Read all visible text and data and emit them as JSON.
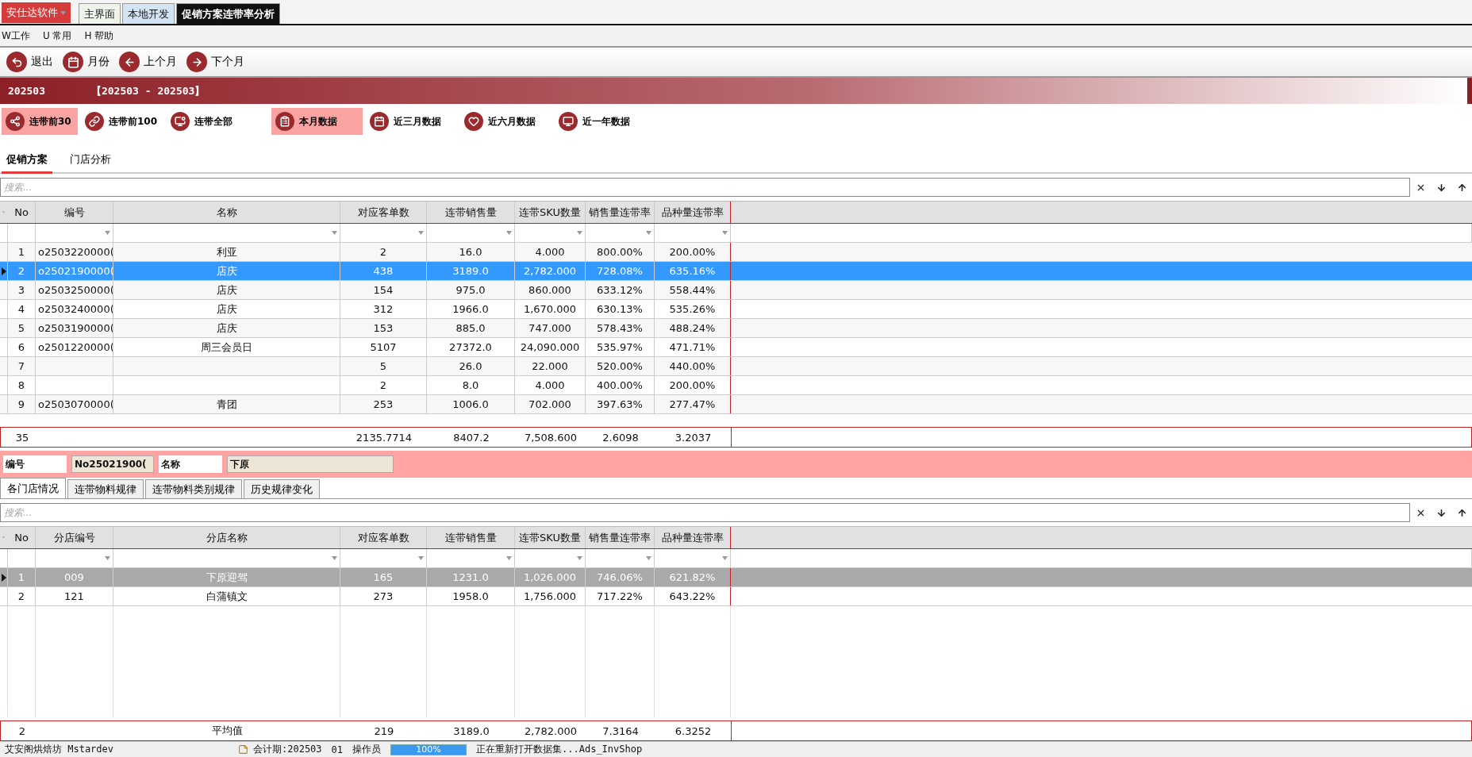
{
  "app_menu": {
    "label": "安仕达软件"
  },
  "window_tabs": [
    {
      "label": "主界面",
      "selected": false,
      "color": "#eef4ea"
    },
    {
      "label": "本地开发",
      "selected": false,
      "color": "#d3e4f5"
    },
    {
      "label": "促销方案连带率分析",
      "selected": true,
      "color": "#111111"
    }
  ],
  "menu": [
    "W工作",
    "U 常用",
    "H 帮助"
  ],
  "toolbar": [
    {
      "label": "退出",
      "kind": "exit"
    },
    {
      "label": "月份",
      "kind": "calendar"
    },
    {
      "label": "上个月",
      "kind": "prev"
    },
    {
      "label": "下个月",
      "kind": "next"
    }
  ],
  "banner": {
    "period": "202503",
    "range": "【202503 - 202503】"
  },
  "scope_buttons": [
    {
      "label": "连带前30",
      "kind": "network",
      "selected": true
    },
    {
      "label": "连带前100",
      "kind": "link",
      "selected": false
    },
    {
      "label": "连带全部",
      "kind": "chart",
      "selected": false
    }
  ],
  "period_buttons": [
    {
      "label": "本月数据",
      "kind": "clipboard",
      "selected": true
    },
    {
      "label": "近三月数据",
      "kind": "calendar",
      "selected": false
    },
    {
      "label": "近六月数据",
      "kind": "heart",
      "selected": false
    },
    {
      "label": "近一年数据",
      "kind": "monitor",
      "selected": false
    }
  ],
  "tabs": [
    {
      "label": "促销方案",
      "selected": true
    },
    {
      "label": "门店分析",
      "selected": false
    }
  ],
  "plan_table": {
    "search": {
      "placeholder": "搜索..."
    },
    "focused": true,
    "columns": [
      "No",
      "编号",
      "名称",
      "对应客单数",
      "连带销售量",
      "连带SKU数量",
      "销售量连带率",
      "品种量连带率"
    ],
    "rows": [
      {
        "no": "1",
        "code": "o2503220000(",
        "name": "利亚",
        "values": [
          "2",
          "16.0",
          "4.000",
          "800.00%",
          "200.00%"
        ],
        "selected": false
      },
      {
        "no": "2",
        "code": "o2502190000(",
        "name": "店庆",
        "values": [
          "438",
          "3189.0",
          "2,782.000",
          "728.08%",
          "635.16%"
        ],
        "selected": true
      },
      {
        "no": "3",
        "code": "o2503250000(",
        "name": "店庆",
        "values": [
          "154",
          "975.0",
          "860.000",
          "633.12%",
          "558.44%"
        ],
        "selected": false
      },
      {
        "no": "4",
        "code": "o2503240000(",
        "name": "店庆",
        "values": [
          "312",
          "1966.0",
          "1,670.000",
          "630.13%",
          "535.26%"
        ],
        "selected": false
      },
      {
        "no": "5",
        "code": "o2503190000(",
        "name": "店庆",
        "values": [
          "153",
          "885.0",
          "747.000",
          "578.43%",
          "488.24%"
        ],
        "selected": false
      },
      {
        "no": "6",
        "code": "o2501220000(",
        "name": "周三会员日",
        "values": [
          "5107",
          "27372.0",
          "24,090.000",
          "535.97%",
          "471.71%"
        ],
        "selected": false
      },
      {
        "no": "7",
        "values": [
          "5",
          "26.0",
          "22.000",
          "520.00%",
          "440.00%"
        ],
        "selected": false
      },
      {
        "no": "8",
        "values": [
          "2",
          "8.0",
          "4.000",
          "400.00%",
          "200.00%"
        ],
        "selected": false
      },
      {
        "no": "9",
        "code": "o2503070000(",
        "name": "青团",
        "values": [
          "253",
          "1006.0",
          "702.000",
          "397.63%",
          "277.47%"
        ],
        "selected": false
      }
    ],
    "footer": {
      "no": "35",
      "values": [
        "2135.7714",
        "8407.2",
        "7,508.600",
        "2.6098",
        "3.2037"
      ]
    }
  },
  "detail": {
    "code_label": "编号",
    "code": "No25021900(",
    "name_label": "名称",
    "name": "下原"
  },
  "detail_tabs": [
    {
      "label": "各门店情况",
      "selected": true
    },
    {
      "label": "连带物料规律",
      "selected": false
    },
    {
      "label": "连带物料类别规律",
      "selected": false
    },
    {
      "label": "历史规律变化",
      "selected": false
    }
  ],
  "store_table": {
    "search": {
      "placeholder": "搜索..."
    },
    "focused": false,
    "columns": [
      "No",
      "分店编号",
      "分店名称",
      "对应客单数",
      "连带销售量",
      "连带SKU数量",
      "销售量连带率",
      "品种量连带率"
    ],
    "rows": [
      {
        "no": "1",
        "code": "009",
        "name": "下原迎驾",
        "values": [
          "165",
          "1231.0",
          "1,026.000",
          "746.06%",
          "621.82%"
        ],
        "selected": true
      },
      {
        "no": "2",
        "code": "121",
        "name": "白蒲镇文",
        "values": [
          "273",
          "1958.0",
          "1,756.000",
          "717.22%",
          "643.22%"
        ],
        "selected": false
      }
    ],
    "footer": {
      "no": "2",
      "name": "平均值",
      "values": [
        "219",
        "3189.0",
        "2,782.000",
        "7.3164",
        "6.3252"
      ]
    }
  },
  "status": {
    "company": "艾安阁烘焙坊 Mstardev",
    "period": "会计期:202503",
    "operator_id": "01",
    "operator": "操作员",
    "progress": {
      "level": 1,
      "reading": "100%"
    },
    "message": "正在重新打开数据集...Ads_InvShop"
  }
}
